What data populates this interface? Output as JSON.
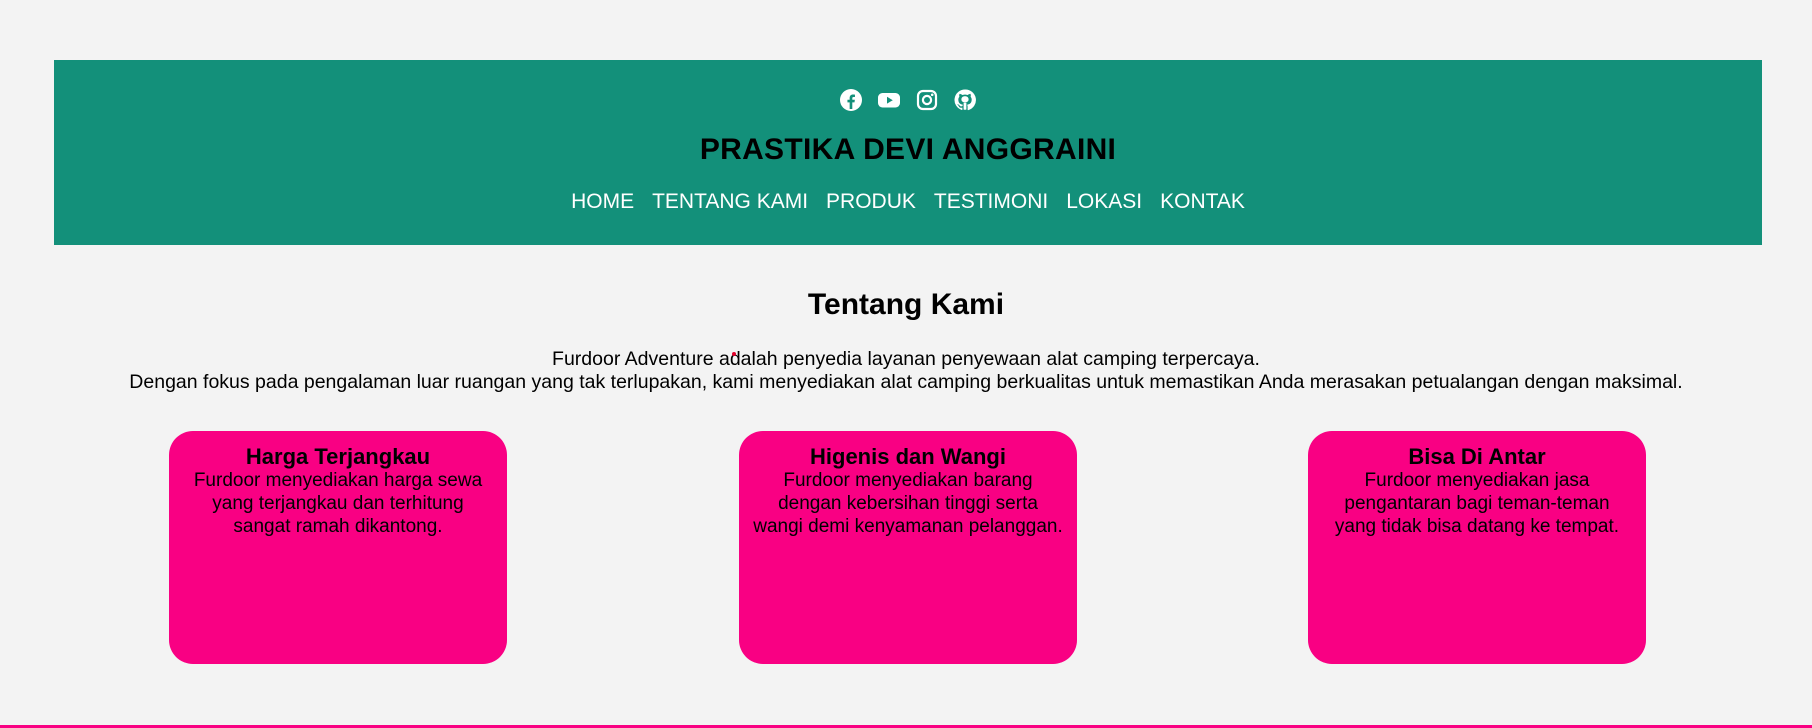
{
  "header": {
    "title": "PRASTIKA DEVI ANGGRAINI",
    "background": "#13907a",
    "social_icons": [
      "facebook-icon",
      "youtube-icon",
      "instagram-icon",
      "github-icon"
    ],
    "nav": [
      "HOME",
      "TENTANG KAMI",
      "PRODUK",
      "TESTIMONI",
      "LOKASI",
      "KONTAK"
    ]
  },
  "about": {
    "title": "Tentang Kami",
    "lines": [
      "Furdoor Adventure adalah penyedia layanan penyewaan alat camping terpercaya.",
      "Dengan fokus pada pengalaman luar ruangan yang tak terlupakan, kami menyediakan alat camping berkualitas untuk memastikan Anda merasakan petualangan dengan maksimal."
    ]
  },
  "cards": [
    {
      "title": "Harga Terjangkau",
      "text": "Furdoor menyediakan harga sewa yang terjangkau dan terhitung sangat ramah dikantong."
    },
    {
      "title": "Higenis dan Wangi",
      "text": "Furdoor menyediakan barang dengan kebersihan tinggi serta wangi demi kenyamanan pelanggan."
    },
    {
      "title": "Bisa Di Antar",
      "text": "Furdoor menyediakan jasa pengantaran bagi teman-teman yang tidak bisa datang ke tempat."
    }
  ],
  "colors": {
    "accent": "#f90083",
    "page_background": "#f3f3f3"
  }
}
